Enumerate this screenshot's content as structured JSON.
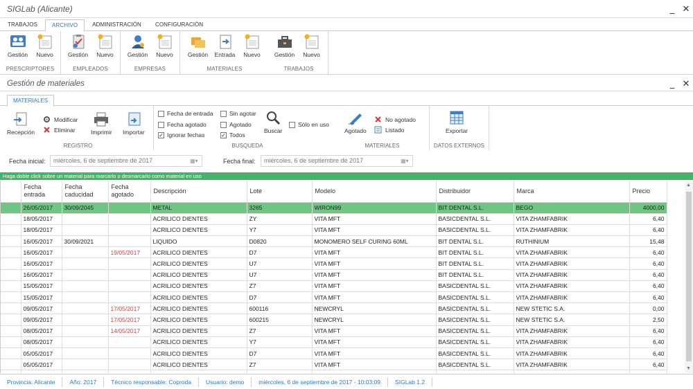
{
  "window": {
    "title": "SIGLab (Alicante)"
  },
  "main_tabs": [
    "TRABAJOS",
    "ARCHIVO",
    "ADMINISTRACIÓN",
    "CONFIGURACIÓN"
  ],
  "ribbon_groups": [
    {
      "label": "PRESCRIPTORES",
      "buttons": [
        "Gestión",
        "Nuevo"
      ]
    },
    {
      "label": "EMPLEADOS",
      "buttons": [
        "Gestión",
        "Nuevo"
      ]
    },
    {
      "label": "EMPRESAS",
      "buttons": [
        "Gestión",
        "Nuevo"
      ]
    },
    {
      "label": "MATERIALES",
      "buttons": [
        "Gestión",
        "Entrada",
        "Nuevo"
      ]
    },
    {
      "label": "TRABAJOS",
      "buttons": [
        "Gestión",
        "Nuevo"
      ]
    }
  ],
  "panel": {
    "title": "Gestión de materiales",
    "tab": "MATERIALES"
  },
  "registro": {
    "label": "REGISTRO",
    "recepcion": "Recepción",
    "modificar": "Modificar",
    "eliminar": "Eliminar",
    "imprimir": "Imprimir",
    "importar": "Importar"
  },
  "busqueda": {
    "label": "BUSQUEDA",
    "checks": [
      {
        "label": "Fecha de entrada",
        "checked": false
      },
      {
        "label": "Fecha agotado",
        "checked": false
      },
      {
        "label": "Ignorar fechas",
        "checked": true
      },
      {
        "label": "Sin agotar",
        "checked": false
      },
      {
        "label": "Agotado",
        "checked": false
      },
      {
        "label": "Todos",
        "checked": true
      }
    ],
    "buscar": "Buscar",
    "solo_en_uso": "Sólo en uso"
  },
  "materiales_group": {
    "label": "MATERIALES",
    "agotado": "Agotado",
    "no_agotado": "No agotado",
    "listado": "Listado"
  },
  "datos_externos": {
    "label": "DATOS EXTERNOS",
    "exportar": "Exportar"
  },
  "dates": {
    "inicial_label": "Fecha inicial:",
    "inicial_value": "miércoles,    6 de septiembre de 2017",
    "final_label": "Fecha final:",
    "final_value": "miércoles,    6 de septiembre de 2017"
  },
  "hint": "Haga doble click sobre un material para marcarlo o desmarcarlo como material en uso",
  "table": {
    "columns": [
      "Fecha entrada",
      "Fecha caducidad",
      "Fecha agotado",
      "Descripción",
      "Lote",
      "Modelo",
      "Distribuidor",
      "Marca",
      "Precio"
    ],
    "rows": [
      [
        "26/05/2017",
        "30/09/2045",
        "",
        "METAL",
        "3265",
        "WIRON99",
        "BIT DENTAL S.L.",
        "BEGO",
        "4000,00"
      ],
      [
        "18/05/2017",
        "",
        "",
        "ACRILICO DIENTES",
        "ZY",
        "VITA MFT",
        "BASICDENTAL S.L.",
        "VITA ZHAMFABRIK",
        "6,40"
      ],
      [
        "18/05/2017",
        "",
        "",
        "ACRILICO DIENTES",
        "Y7",
        "VITA MFT",
        "BASICDENTAL S.L.",
        "VITA ZHAMFABRIK",
        "6,40"
      ],
      [
        "16/05/2017",
        "30/09/2021",
        "",
        "LIQUIDO",
        "D0820",
        "MONOMERO SELF CURING 60ML",
        "BIT DENTAL S.L.",
        "RUTHINIUM",
        "15,48"
      ],
      [
        "16/05/2017",
        "",
        "19/05/2017",
        "ACRILICO DIENTES",
        "D7",
        "VITA MFT",
        "BIT DENTAL S.L.",
        "VITA ZHAMFABRIK",
        "6,40"
      ],
      [
        "16/05/2017",
        "",
        "",
        "ACRILICO DIENTES",
        "U7",
        "VITA MFT",
        "BIT DENTAL S.L.",
        "VITA ZHAMFABRIK",
        "6,40"
      ],
      [
        "16/05/2017",
        "",
        "",
        "ACRILICO DIENTES",
        "U7",
        "VITA MFT",
        "BIT DENTAL S.L.",
        "VITA ZHAMFABRIK",
        "6,40"
      ],
      [
        "15/05/2017",
        "",
        "",
        "ACRILICO DIENTES",
        "Z7",
        "VITA MFT",
        "BASICDENTAL S.L.",
        "VITA ZHAMFABRIK",
        "6,40"
      ],
      [
        "15/05/2017",
        "",
        "",
        "ACRILICO DIENTES",
        "D7",
        "VITA MFT",
        "BASICDENTAL S.L.",
        "VITA ZHAMFABRIK",
        "6,40"
      ],
      [
        "09/05/2017",
        "",
        "17/05/2017",
        "ACRILICO DIENTES",
        "600116",
        "NEWCRYL",
        "BASICDENTAL S.L.",
        "NEW STETIC S.A.",
        "0,00"
      ],
      [
        "09/05/2017",
        "",
        "17/05/2017",
        "ACRILICO DIENTES",
        "600215",
        "NEWCRYL",
        "BASICDENTAL S.L.",
        "NEW STETIC S.A.",
        "2,50"
      ],
      [
        "08/05/2017",
        "",
        "14/05/2017",
        "ACRILICO DIENTES",
        "Z7",
        "VITA MFT",
        "BASICDENTAL S.L.",
        "VITA ZHAMFABRIK",
        "6,40"
      ],
      [
        "08/05/2017",
        "",
        "",
        "ACRILICO DIENTES",
        "Y7",
        "VITA MFT",
        "BASICDENTAL S.L.",
        "VITA ZHAMFABRIK",
        "6,40"
      ],
      [
        "05/05/2017",
        "",
        "",
        "ACRILICO DIENTES",
        "D7",
        "VITA MFT",
        "BASICDENTAL S.L.",
        "VITA ZHAMFABRIK",
        "6,40"
      ],
      [
        "05/05/2017",
        "",
        "",
        "ACRILICO DIENTES",
        "Z7",
        "VITA MFT",
        "BASICDENTAL S.L.",
        "VITA ZHAMFABRIK",
        "6,40"
      ],
      [
        "",
        "",
        "",
        "",
        "",
        "",
        "",
        "",
        ""
      ]
    ]
  },
  "status": [
    "Provincia: Alicante",
    "Año: 2017",
    "Técnico responsable: Coproda",
    "Usuario: demo",
    "miércoles, 6 de septiembre de 2017 - 10:03:09",
    "SIGLab 1.2"
  ],
  "colors": {
    "accent": "#2b78c7",
    "selected_row": "#6fc683",
    "hint_bar": "#47b26a",
    "exhausted_date": "#e03c3c"
  }
}
